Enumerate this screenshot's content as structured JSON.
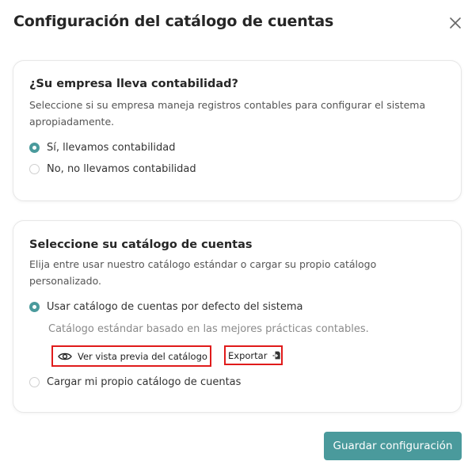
{
  "dialog": {
    "title": "Configuración del catálogo de cuentas",
    "close_icon": "close-icon"
  },
  "accounting_section": {
    "title": "¿Su empresa lleva contabilidad?",
    "description": "Seleccione si su empresa maneja registros contables para configurar el sistema apropiadamente.",
    "options": [
      {
        "label": "Sí, llevamos contabilidad",
        "selected": true
      },
      {
        "label": "No, no llevamos contabilidad",
        "selected": false
      }
    ]
  },
  "catalog_section": {
    "title": "Seleccione su catálogo de cuentas",
    "description": "Elija entre usar nuestro catálogo estándar o cargar su propio catálogo personalizado.",
    "options": [
      {
        "label": "Usar catálogo de cuentas por defecto del sistema",
        "selected": true
      },
      {
        "label": "Cargar mi propio catálogo de cuentas",
        "selected": false
      }
    ],
    "default_description": "Catálogo estándar basado en las mejores prácticas contables.",
    "preview_button": {
      "label": "Ver vista previa del catálogo",
      "icon": "eye-icon"
    },
    "export_button": {
      "label": "Exportar",
      "icon": "export-file-icon"
    }
  },
  "footer": {
    "save_label": "Guardar configuración"
  },
  "colors": {
    "accent": "#4a9a9c",
    "highlight_border": "#e01b1b"
  }
}
